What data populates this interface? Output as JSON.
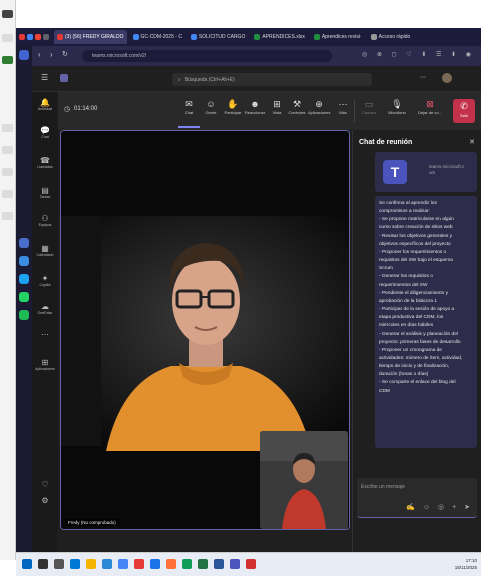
{
  "browser": {
    "tabs": [
      {
        "label": "(3) (56) FREDY GIRALDO",
        "color": "#e53935",
        "active": true
      },
      {
        "label": "GC-CDM-2025 - C",
        "color": "#4285f4",
        "active": false
      },
      {
        "label": "SOLICITUD CARGO",
        "color": "#4285f4",
        "active": false
      },
      {
        "label": "APRENDICES.xlsx",
        "color": "#1e8e3e",
        "active": false
      },
      {
        "label": "Aprendices revisi·",
        "color": "#1e8e3e",
        "active": false
      },
      {
        "label": "Acceso rápido",
        "color": "#999999",
        "active": false
      }
    ],
    "url": "teams.microsoft.com/v2/"
  },
  "teams": {
    "search_placeholder": "Búsqueda (Ctrl+Alt+E)",
    "rail": [
      {
        "label": "Actividad",
        "icon": "bell-icon"
      },
      {
        "label": "Chat",
        "icon": "chat-icon"
      },
      {
        "label": "Llamadas",
        "icon": "phone-icon"
      },
      {
        "label": "Tareas",
        "icon": "tasks-icon"
      },
      {
        "label": "Equipos",
        "icon": "teams-icon"
      },
      {
        "label": "Calendario",
        "icon": "calendar-icon"
      },
      {
        "label": "Copilot",
        "icon": "copilot-icon"
      },
      {
        "label": "OneDrive",
        "icon": "cloud-icon"
      },
      {
        "label": "",
        "icon": "more-icon"
      },
      {
        "label": "Aplicaciones",
        "icon": "apps-icon"
      }
    ],
    "meeting": {
      "timer": "01:14:00",
      "buttons": [
        {
          "label": "Chat",
          "glyph": "✉"
        },
        {
          "label": "Gente",
          "glyph": "☺"
        },
        {
          "label": "Participar",
          "glyph": "✋"
        },
        {
          "label": "Reaccionar",
          "glyph": "☻"
        },
        {
          "label": "Vista",
          "glyph": "⊞"
        },
        {
          "label": "Controles",
          "glyph": "⚒"
        },
        {
          "label": "Aplicaciones",
          "glyph": "⊕"
        },
        {
          "label": "Más",
          "glyph": "⋯"
        }
      ],
      "camera_label": "Cámara",
      "mic_label": "Micrófono",
      "share_label": "Dejar de co...",
      "leave_label": "Salir"
    },
    "video": {
      "participant_name": "Fredy (No comprobado)"
    },
    "chat": {
      "title": "Chat de reunión",
      "card_text_1": "teams.microsoft.c",
      "card_text_2": "om",
      "message_lines": [
        "Se confirma al aprendiz los",
        "compromisos a realizar:",
        "- Se propone matricularse en algún",
        "curso sobre creación de sitios web",
        "- Revisar los objetivos generales y",
        "objetivos específicos del proyecto",
        "- Proponer los requerimientos o",
        "requisitos del SW bajo el esquema",
        "Scrum",
        "- Generar los requisitos o",
        "requerimientos del SW",
        "- Pendiente el diligenciamiento y",
        "aprobación de la bitácora 1",
        "- Participar de la sesión de apoyo a",
        "etapa productiva del CDM, los",
        "miércoles en días hábiles",
        "- Generar el análisis y planeación del",
        "proyecto: primeras fases de desarrollo",
        "- Proponer un cronograma de",
        "actividades: número de ítem, actividad,",
        "tiempo de inicio y de finalización,",
        "duración (horas o días)",
        "- Se comparte el enlace del blog del",
        "CDM"
      ],
      "compose_placeholder": "Escribe un mensaje"
    }
  },
  "taskbar": {
    "time": "17:10",
    "date": "18/11/2025"
  }
}
